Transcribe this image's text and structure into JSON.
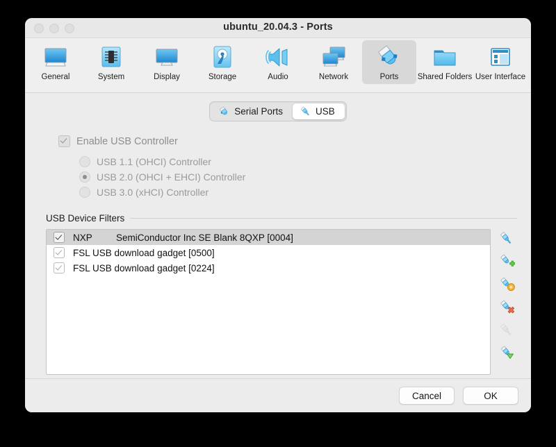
{
  "window": {
    "title": "ubuntu_20.04.3 - Ports",
    "traffic_lights": [
      "close",
      "minimize",
      "zoom"
    ]
  },
  "toolbar": {
    "items": [
      {
        "label": "General",
        "icon": "general-icon",
        "selected": false
      },
      {
        "label": "System",
        "icon": "system-icon",
        "selected": false
      },
      {
        "label": "Display",
        "icon": "display-icon",
        "selected": false
      },
      {
        "label": "Storage",
        "icon": "storage-icon",
        "selected": false
      },
      {
        "label": "Audio",
        "icon": "audio-icon",
        "selected": false
      },
      {
        "label": "Network",
        "icon": "network-icon",
        "selected": false
      },
      {
        "label": "Ports",
        "icon": "ports-icon",
        "selected": true
      },
      {
        "label": "Shared Folders",
        "icon": "shared-folders-icon",
        "selected": false
      },
      {
        "label": "User Interface",
        "icon": "user-interface-icon",
        "selected": false
      }
    ]
  },
  "tabs": [
    {
      "label": "Serial Ports",
      "icon": "serial-ports-icon",
      "active": false
    },
    {
      "label": "USB",
      "icon": "usb-plug-icon",
      "active": true
    }
  ],
  "usb": {
    "enable_controller": {
      "label": "Enable USB Controller",
      "checked": true,
      "disabled": true
    },
    "controller_options": [
      {
        "label": "USB 1.1 (OHCI) Controller",
        "selected": false
      },
      {
        "label": "USB 2.0 (OHCI + EHCI) Controller",
        "selected": true
      },
      {
        "label": "USB 3.0 (xHCI) Controller",
        "selected": false
      }
    ],
    "filters_group_title": "USB Device Filters",
    "filters": [
      {
        "checked": true,
        "vendor": "NXP",
        "name": "SemiConductor Inc SE Blank 8QXP [0004]",
        "selected": true
      },
      {
        "checked": true,
        "vendor": "",
        "name": "FSL USB download gadget [0500]",
        "selected": false
      },
      {
        "checked": true,
        "vendor": "",
        "name": "FSL USB download gadget [0224]",
        "selected": false
      }
    ],
    "filter_actions": [
      {
        "name": "add-empty-filter-button",
        "badge": "none",
        "disabled": false
      },
      {
        "name": "add-filter-from-device-button",
        "badge": "plus",
        "disabled": false
      },
      {
        "name": "edit-filter-button",
        "badge": "edit",
        "disabled": false
      },
      {
        "name": "remove-filter-button",
        "badge": "remove",
        "disabled": false
      },
      {
        "name": "move-filter-up-button",
        "badge": "up",
        "disabled": true
      },
      {
        "name": "move-filter-down-button",
        "badge": "down",
        "disabled": false
      }
    ]
  },
  "footer": {
    "cancel_label": "Cancel",
    "ok_label": "OK"
  },
  "colors": {
    "accent_blue": "#3ea8e8",
    "icon_blue_dark": "#1f7ec4",
    "selection_gray": "#d4d4d4",
    "window_bg": "#ececec",
    "badge_green": "#5cc04a",
    "badge_orange": "#f0a830",
    "badge_red": "#e8664a"
  }
}
